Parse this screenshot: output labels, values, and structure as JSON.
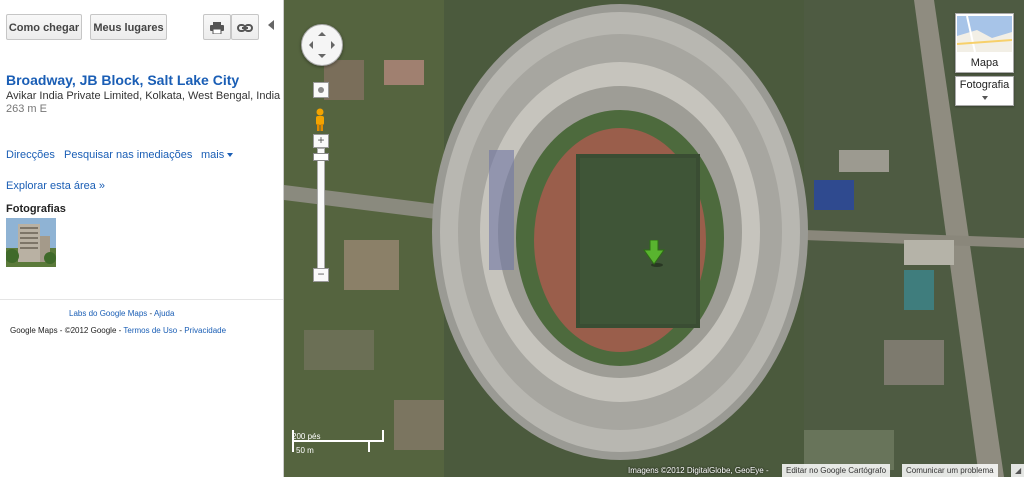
{
  "toolbar": {
    "directions_label": "Como chegar",
    "my_places_label": "Meus lugares"
  },
  "place": {
    "title": "Broadway, JB Block, Salt Lake City",
    "address": "Avikar India Private Limited, Kolkata, West Bengal, India",
    "distance": "263 m E"
  },
  "actions": {
    "directions": "Direcções",
    "search_nearby": "Pesquisar nas imediações",
    "more": "mais",
    "explore": "Explorar esta área »"
  },
  "photos": {
    "heading": "Fotografias"
  },
  "footer": {
    "labs": "Labs do Google Maps",
    "sep": " - ",
    "help": "Ajuda",
    "copyright": "Google Maps - ©2012 Google - ",
    "terms": "Termos de Uso",
    "privacy": "Privacidade"
  },
  "map": {
    "map_type_label": "Mapa",
    "photo_layer_label": "Fotografia",
    "scale_ft": "200 pés",
    "scale_m": "50 m",
    "imagery_credit": "Imagens ©2012 DigitalGlobe, GeoEye -",
    "edit_link": "Editar no Google Cartógrafo",
    "report_link": "Comunicar um problema"
  },
  "colors": {
    "link_blue": "#1a5eb5",
    "marker_green": "#59b42f"
  },
  "icons": [
    "print-icon",
    "link-icon",
    "collapse-arrow-icon",
    "pan-control-icon",
    "pegman-icon",
    "zoom-in-icon",
    "zoom-out-icon",
    "location-marker-icon",
    "chevron-down-icon"
  ]
}
